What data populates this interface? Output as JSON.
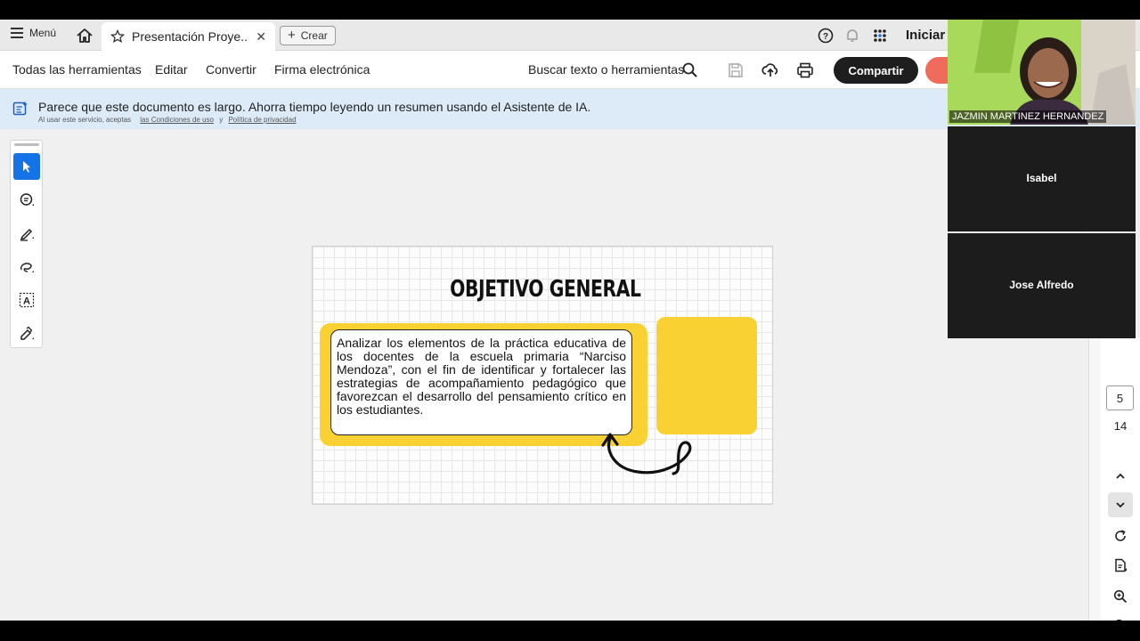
{
  "tabbar": {
    "menu_label": "Menú",
    "tab_title": "Presentación Proye...",
    "create_label": "Crear",
    "signin_label": "Iniciar"
  },
  "toolbar": {
    "all_tools": "Todas las herramientas",
    "edit": "Editar",
    "convert": "Convertir",
    "esign": "Firma electrónica",
    "search": "Buscar texto o herramientas",
    "share": "Compartir"
  },
  "banner": {
    "message": "Parece que este documento es largo. Ahorra tiempo leyendo un resumen usando el Asistente de IA.",
    "legal_prefix": "Al usar este servicio, aceptas",
    "terms": "las Condiciones de uso",
    "and": "y",
    "privacy": "Política de privacidad"
  },
  "slide": {
    "title": "OBJETIVO GENERAL",
    "body": "Analizar los elementos de la práctica educativa de los docentes de la escuela primaria “Narciso Mendoza”, con el fin de identificar y fortalecer las estrategias de acompañamiento pedagógico que favorezcan el desarrollo del pensamiento crítico en los estudiantes."
  },
  "pager": {
    "current_page": "5",
    "total_pages": "14"
  },
  "participants": [
    {
      "name": "JAZMIN MARTINEZ HERNANDEZ"
    },
    {
      "name": "Isabel"
    },
    {
      "name": "Jose Alfredo"
    }
  ],
  "colors": {
    "accent_blue": "#1473e6",
    "slide_yellow": "#fad132",
    "share_button": "#1e1e1e",
    "banner_bg": "#ddeaf8"
  }
}
